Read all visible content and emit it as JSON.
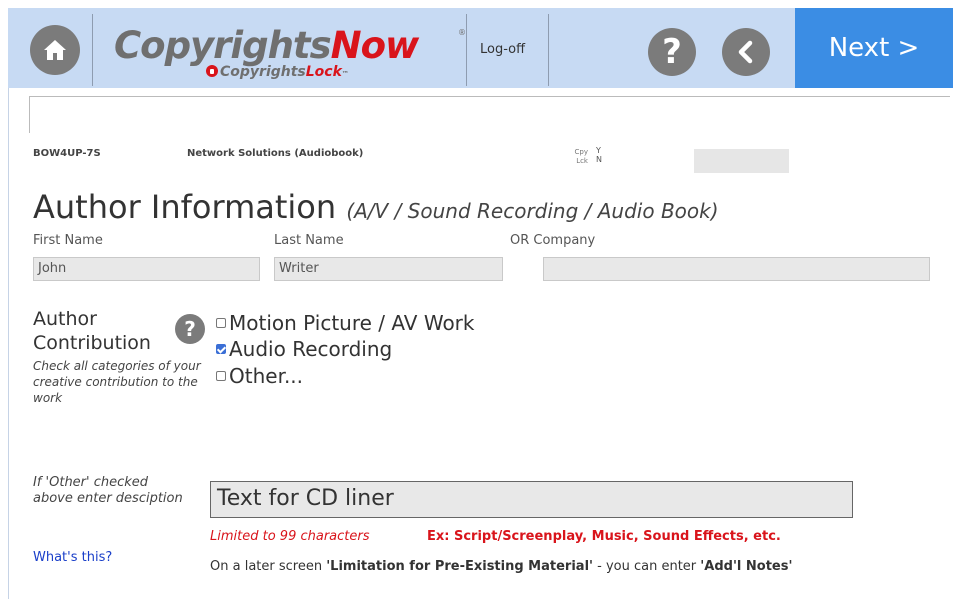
{
  "header": {
    "logo_main": "Copyrights",
    "logo_now": "Now",
    "logo_reg": "®",
    "logo_sub_prefix": "Copyrights",
    "logo_sub_lock": "Lock",
    "logo_sub_tm": "™",
    "logoff_label": "Log-off",
    "help_symbol": "?",
    "next_label": "Next >"
  },
  "record": {
    "code": "BOW4UP-7S",
    "title": "Network Solutions (Audiobook)",
    "cpy_label": "Cpy",
    "cpy_value": "Y",
    "lck_label": "Lck",
    "lck_value": "N"
  },
  "page": {
    "title": "Author Information",
    "subtitle": "(A/V / Sound Recording / Audio Book)"
  },
  "author": {
    "first_name_label": "First Name",
    "first_name_value": "John",
    "last_name_label": "Last Name",
    "last_name_value": "Writer",
    "company_label": "OR  Company",
    "company_value": ""
  },
  "contribution": {
    "label_line1": "Author",
    "label_line2": "Contribution",
    "note": "Check all categories of your creative contribution to the work",
    "help_symbol": "?",
    "options": [
      {
        "label": "Motion Picture / AV Work",
        "checked": false
      },
      {
        "label": "Audio Recording",
        "checked": true
      },
      {
        "label": "Other...",
        "checked": false
      }
    ]
  },
  "other": {
    "label": "If 'Other' checked above enter desciption",
    "value": "Text for CD liner",
    "limit_note": "Limited to 99 characters",
    "example_note": "Ex: Script/Screenplay, Music, Sound Effects, etc.",
    "whats_this": "What's this?",
    "later_prefix": "On a later screen ",
    "later_bold1": "'Limitation for Pre-Existing Material'",
    "later_mid": " - you can enter ",
    "later_bold2": "'Add'l Notes'"
  },
  "colors": {
    "header_bg": "#c7daf3",
    "next_bg": "#3b8de4",
    "brand_red": "#d9141b",
    "icon_grey": "#7b7b7b"
  }
}
